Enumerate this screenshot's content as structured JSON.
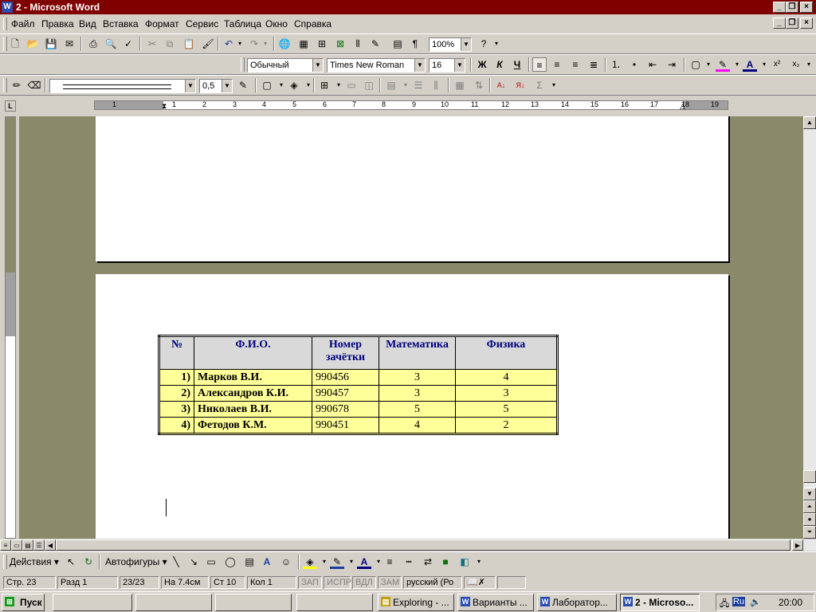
{
  "window": {
    "title": "2 - Microsoft Word"
  },
  "menu": [
    "Файл",
    "Правка",
    "Вид",
    "Вставка",
    "Формат",
    "Сервис",
    "Таблица",
    "Окно",
    "Справка"
  ],
  "standard_toolbar": {
    "zoom": "100%"
  },
  "formatting_toolbar": {
    "style": "Обычный",
    "font": "Times New Roman",
    "size": "16",
    "bold": "Ж",
    "italic": "К",
    "underline": "Ч"
  },
  "tables_toolbar": {
    "line_weight": "0,5"
  },
  "ruler": {
    "labels": [
      "1",
      "1",
      "2",
      "3",
      "4",
      "5",
      "6",
      "7",
      "8",
      "9",
      "10",
      "11",
      "12",
      "13",
      "14",
      "15",
      "16",
      "17",
      "18",
      "19"
    ]
  },
  "table": {
    "headers": [
      "№",
      "Ф.И.О.",
      "Номер зачётки",
      "Математика",
      "Физика"
    ],
    "rows": [
      [
        "1)",
        "Марков В.И.",
        "990456",
        "3",
        "4"
      ],
      [
        "2)",
        "Александров К.И.",
        "990457",
        "3",
        "3"
      ],
      [
        "3)",
        "Николаев В.И.",
        "990678",
        "5",
        "5"
      ],
      [
        "4)",
        "Фетодов К.М.",
        "990451",
        "4",
        "2"
      ]
    ]
  },
  "drawing_toolbar": {
    "actions": "Действия",
    "autoshapes": "Автофигуры"
  },
  "status": {
    "page": "Стр. 23",
    "section": "Разд 1",
    "pages": "23/23",
    "at": "На 7.4см",
    "line": "Ст 10",
    "col": "Кол 1",
    "rec": "ЗАП",
    "trk": "ИСПР",
    "ext": "ВДЛ",
    "ovr": "ЗАМ",
    "lang": "русский (Ро"
  },
  "taskbar": {
    "start": "Пуск",
    "tasks": [
      "Exploring - ...",
      "Варианты ...",
      "Лаборатор...",
      "2 - Microso..."
    ],
    "clock": "20:00",
    "lang": "Ru"
  }
}
